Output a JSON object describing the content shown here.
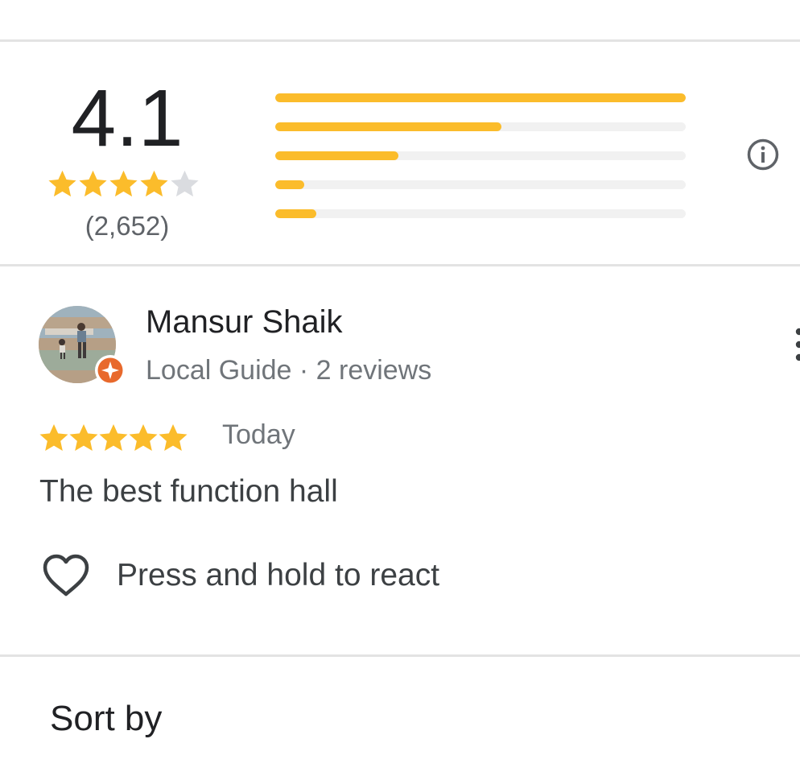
{
  "summary": {
    "average": "4.1",
    "rating_stars": 4.1,
    "review_count": "(2,652)",
    "distribution_fractions": [
      1.0,
      0.55,
      0.3,
      0.07,
      0.1
    ]
  },
  "review": {
    "reviewer_name": "Mansur Shaik",
    "reviewer_meta": "Local Guide · 2 reviews",
    "rating": 5,
    "date": "Today",
    "text": "The best function hall",
    "react_label": "Press and hold to react"
  },
  "sort": {
    "label": "Sort by"
  },
  "colors": {
    "star": "#fbbc2b",
    "star_empty": "#dadce0",
    "track": "#f1f1f1",
    "guide_badge": "#e8692c"
  },
  "icons": [
    "info-icon",
    "local-guide-badge-icon",
    "more-vert-icon",
    "heart-icon"
  ]
}
